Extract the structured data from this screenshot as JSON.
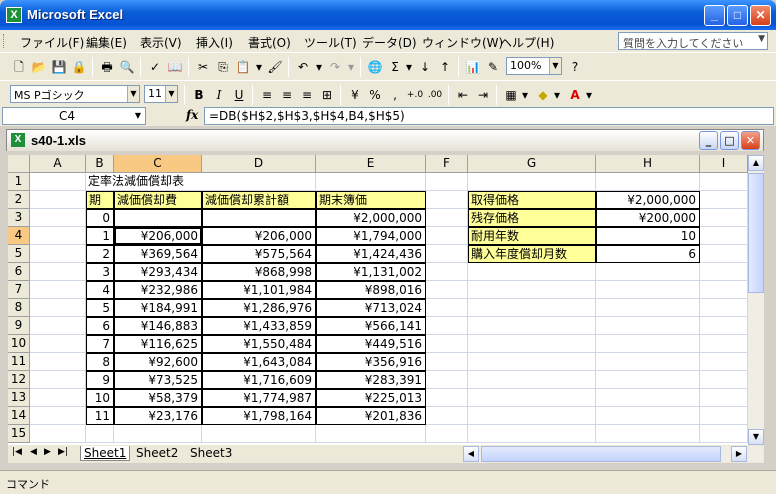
{
  "window": {
    "title": "Microsoft Excel",
    "app_icon": "X"
  },
  "menu": [
    "ファイル(F)",
    "編集(E)",
    "表示(V)",
    "挿入(I)",
    "書式(O)",
    "ツール(T)",
    "データ(D)",
    "ウィンドウ(W)",
    "ヘルプ(H)"
  ],
  "help_placeholder": "質問を入力してください",
  "toolbar": {
    "zoom": "100%",
    "font_name": "MS Pゴシック",
    "font_size": "11"
  },
  "formula_bar": {
    "name_box": "C4",
    "fx": "fx",
    "formula": "=DB($H$2,$H$3,$H$4,B4,$H$5)"
  },
  "workbook": {
    "title": "s40-1.xls"
  },
  "columns": [
    "A",
    "B",
    "C",
    "D",
    "E",
    "F",
    "G",
    "H",
    "I"
  ],
  "rows": [
    "1",
    "2",
    "3",
    "4",
    "5",
    "6",
    "7",
    "8",
    "9",
    "10",
    "11",
    "12",
    "13",
    "14",
    "15"
  ],
  "sheet": {
    "title": "定率法減価償却表",
    "headers": [
      "期",
      "減価償却費",
      "減価償却累計額",
      "期末簿価"
    ],
    "table": [
      [
        "0",
        "",
        "",
        "¥2,000,000"
      ],
      [
        "1",
        "¥206,000",
        "¥206,000",
        "¥1,794,000"
      ],
      [
        "2",
        "¥369,564",
        "¥575,564",
        "¥1,424,436"
      ],
      [
        "3",
        "¥293,434",
        "¥868,998",
        "¥1,131,002"
      ],
      [
        "4",
        "¥232,986",
        "¥1,101,984",
        "¥898,016"
      ],
      [
        "5",
        "¥184,991",
        "¥1,286,976",
        "¥713,024"
      ],
      [
        "6",
        "¥146,883",
        "¥1,433,859",
        "¥566,141"
      ],
      [
        "7",
        "¥116,625",
        "¥1,550,484",
        "¥449,516"
      ],
      [
        "8",
        "¥92,600",
        "¥1,643,084",
        "¥356,916"
      ],
      [
        "9",
        "¥73,525",
        "¥1,716,609",
        "¥283,391"
      ],
      [
        "10",
        "¥58,379",
        "¥1,774,987",
        "¥225,013"
      ],
      [
        "11",
        "¥23,176",
        "¥1,798,164",
        "¥201,836"
      ]
    ],
    "params": [
      [
        "取得価格",
        "¥2,000,000"
      ],
      [
        "残存価格",
        "¥200,000"
      ],
      [
        "耐用年数",
        "10"
      ],
      [
        "購入年度償却月数",
        "6"
      ]
    ]
  },
  "tabs": [
    "Sheet1",
    "Sheet2",
    "Sheet3"
  ],
  "status": "コマンド",
  "colors": {
    "header_fill": "#ffff99",
    "selected_header": "#f7c982",
    "title_bar": "#0553d3"
  }
}
